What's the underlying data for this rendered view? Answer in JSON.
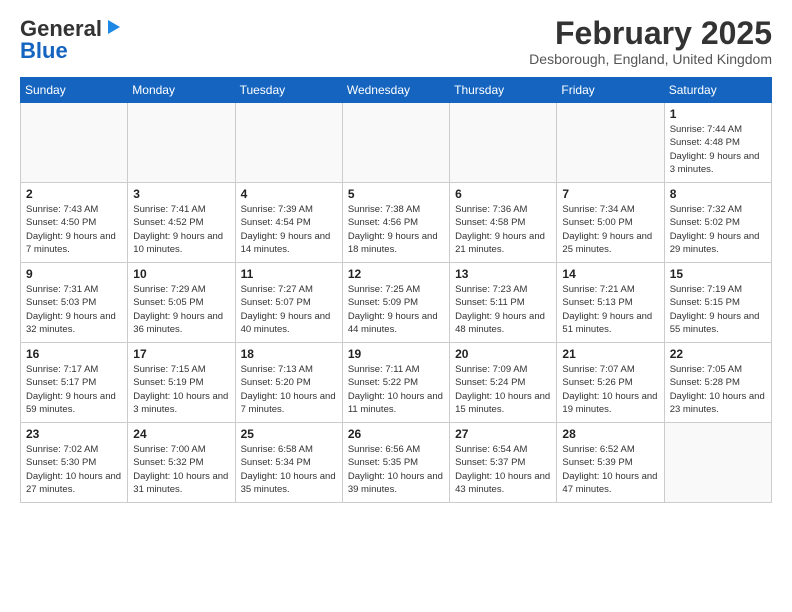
{
  "header": {
    "logo_general": "General",
    "logo_blue": "Blue",
    "month_year": "February 2025",
    "location": "Desborough, England, United Kingdom"
  },
  "days_of_week": [
    "Sunday",
    "Monday",
    "Tuesday",
    "Wednesday",
    "Thursday",
    "Friday",
    "Saturday"
  ],
  "weeks": [
    [
      {
        "day": "",
        "info": ""
      },
      {
        "day": "",
        "info": ""
      },
      {
        "day": "",
        "info": ""
      },
      {
        "day": "",
        "info": ""
      },
      {
        "day": "",
        "info": ""
      },
      {
        "day": "",
        "info": ""
      },
      {
        "day": "1",
        "info": "Sunrise: 7:44 AM\nSunset: 4:48 PM\nDaylight: 9 hours and 3 minutes."
      }
    ],
    [
      {
        "day": "2",
        "info": "Sunrise: 7:43 AM\nSunset: 4:50 PM\nDaylight: 9 hours and 7 minutes."
      },
      {
        "day": "3",
        "info": "Sunrise: 7:41 AM\nSunset: 4:52 PM\nDaylight: 9 hours and 10 minutes."
      },
      {
        "day": "4",
        "info": "Sunrise: 7:39 AM\nSunset: 4:54 PM\nDaylight: 9 hours and 14 minutes."
      },
      {
        "day": "5",
        "info": "Sunrise: 7:38 AM\nSunset: 4:56 PM\nDaylight: 9 hours and 18 minutes."
      },
      {
        "day": "6",
        "info": "Sunrise: 7:36 AM\nSunset: 4:58 PM\nDaylight: 9 hours and 21 minutes."
      },
      {
        "day": "7",
        "info": "Sunrise: 7:34 AM\nSunset: 5:00 PM\nDaylight: 9 hours and 25 minutes."
      },
      {
        "day": "8",
        "info": "Sunrise: 7:32 AM\nSunset: 5:02 PM\nDaylight: 9 hours and 29 minutes."
      }
    ],
    [
      {
        "day": "9",
        "info": "Sunrise: 7:31 AM\nSunset: 5:03 PM\nDaylight: 9 hours and 32 minutes."
      },
      {
        "day": "10",
        "info": "Sunrise: 7:29 AM\nSunset: 5:05 PM\nDaylight: 9 hours and 36 minutes."
      },
      {
        "day": "11",
        "info": "Sunrise: 7:27 AM\nSunset: 5:07 PM\nDaylight: 9 hours and 40 minutes."
      },
      {
        "day": "12",
        "info": "Sunrise: 7:25 AM\nSunset: 5:09 PM\nDaylight: 9 hours and 44 minutes."
      },
      {
        "day": "13",
        "info": "Sunrise: 7:23 AM\nSunset: 5:11 PM\nDaylight: 9 hours and 48 minutes."
      },
      {
        "day": "14",
        "info": "Sunrise: 7:21 AM\nSunset: 5:13 PM\nDaylight: 9 hours and 51 minutes."
      },
      {
        "day": "15",
        "info": "Sunrise: 7:19 AM\nSunset: 5:15 PM\nDaylight: 9 hours and 55 minutes."
      }
    ],
    [
      {
        "day": "16",
        "info": "Sunrise: 7:17 AM\nSunset: 5:17 PM\nDaylight: 9 hours and 59 minutes."
      },
      {
        "day": "17",
        "info": "Sunrise: 7:15 AM\nSunset: 5:19 PM\nDaylight: 10 hours and 3 minutes."
      },
      {
        "day": "18",
        "info": "Sunrise: 7:13 AM\nSunset: 5:20 PM\nDaylight: 10 hours and 7 minutes."
      },
      {
        "day": "19",
        "info": "Sunrise: 7:11 AM\nSunset: 5:22 PM\nDaylight: 10 hours and 11 minutes."
      },
      {
        "day": "20",
        "info": "Sunrise: 7:09 AM\nSunset: 5:24 PM\nDaylight: 10 hours and 15 minutes."
      },
      {
        "day": "21",
        "info": "Sunrise: 7:07 AM\nSunset: 5:26 PM\nDaylight: 10 hours and 19 minutes."
      },
      {
        "day": "22",
        "info": "Sunrise: 7:05 AM\nSunset: 5:28 PM\nDaylight: 10 hours and 23 minutes."
      }
    ],
    [
      {
        "day": "23",
        "info": "Sunrise: 7:02 AM\nSunset: 5:30 PM\nDaylight: 10 hours and 27 minutes."
      },
      {
        "day": "24",
        "info": "Sunrise: 7:00 AM\nSunset: 5:32 PM\nDaylight: 10 hours and 31 minutes."
      },
      {
        "day": "25",
        "info": "Sunrise: 6:58 AM\nSunset: 5:34 PM\nDaylight: 10 hours and 35 minutes."
      },
      {
        "day": "26",
        "info": "Sunrise: 6:56 AM\nSunset: 5:35 PM\nDaylight: 10 hours and 39 minutes."
      },
      {
        "day": "27",
        "info": "Sunrise: 6:54 AM\nSunset: 5:37 PM\nDaylight: 10 hours and 43 minutes."
      },
      {
        "day": "28",
        "info": "Sunrise: 6:52 AM\nSunset: 5:39 PM\nDaylight: 10 hours and 47 minutes."
      },
      {
        "day": "",
        "info": ""
      }
    ]
  ]
}
